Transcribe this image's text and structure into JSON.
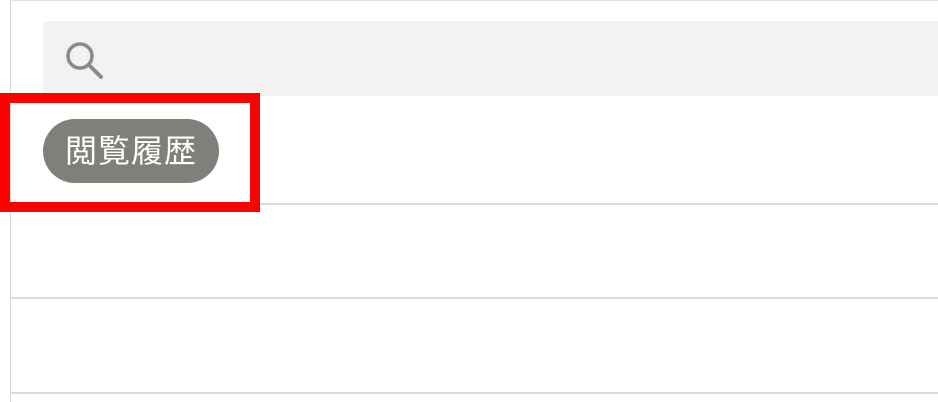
{
  "search": {
    "placeholder": "",
    "value": "",
    "icon": "search-icon"
  },
  "history_chip": {
    "label": "閲覧履歴"
  },
  "list": {
    "rows": [
      "",
      ""
    ]
  },
  "colors": {
    "search_bg": "#f2f2f2",
    "chip_bg": "#7f807a",
    "chip_text": "#ffffff",
    "divider": "#dcdcdc",
    "highlight": "#ff0000"
  }
}
